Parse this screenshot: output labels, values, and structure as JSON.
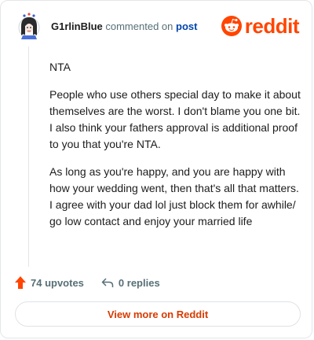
{
  "header": {
    "username": "G1rlinBlue",
    "action_text": "commented on",
    "post_link": "post",
    "logo_text": "reddit"
  },
  "comment": {
    "paragraphs": [
      "NTA",
      "People who use others special day to make it about themselves are the worst. I don't blame you one bit. I also think your fathers approval is additional proof to you that you're NTA.",
      "As long as you're happy, and you are happy with how your wedding went, then that's all that matters. I agree with your dad lol just block them for awhile/ go low contact and enjoy your married life"
    ]
  },
  "actions": {
    "upvotes": "74 upvotes",
    "replies": "0 replies"
  },
  "view_more": "View more on Reddit",
  "colors": {
    "brand": "#ff4500",
    "link": "#0045ac",
    "view_more": "#d93a00"
  }
}
